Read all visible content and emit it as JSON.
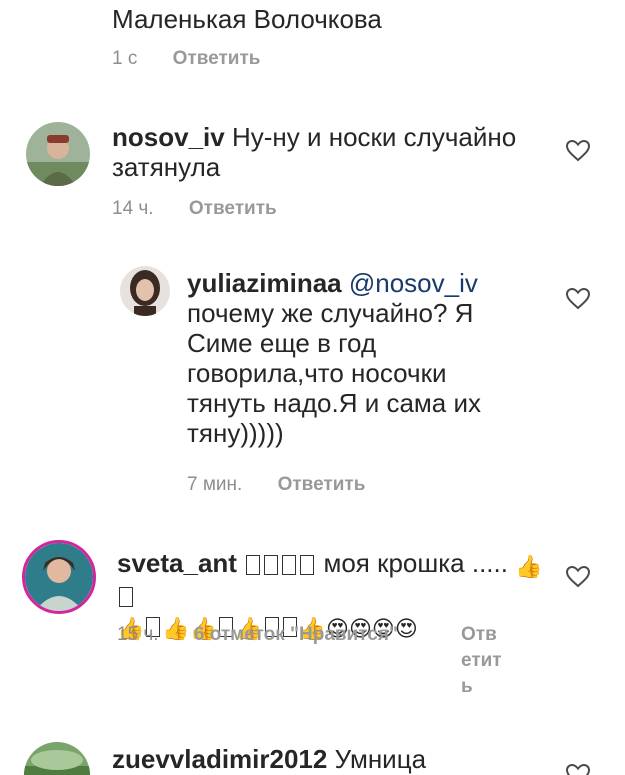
{
  "top_partial": {
    "text": "Маленькая Волочкова",
    "time": "1 с",
    "reply": "Ответить"
  },
  "comments": [
    {
      "username": "nosov_iv",
      "text": "Ну-ну и носки случайно затянула",
      "time": "14 ч.",
      "reply": "Ответить"
    },
    {
      "username": "yuliaziminaa",
      "mention": "@nosov_iv",
      "text": "почему же случайно? Я Симе еще в год говорила,что носочки тянуть надо.Я и сама их тяну)))))",
      "time": "7 мин.",
      "reply": "Ответить"
    },
    {
      "username": "sveta_ant",
      "text": "моя крошка .....",
      "time": "15 ч.",
      "likes": "6 отметок \"Нравится\"",
      "reply_lines": [
        "Отв",
        "етит",
        "ь"
      ]
    },
    {
      "username": "zuevvladimir2012",
      "text": "Умница"
    }
  ],
  "icons": {
    "like": "heart-outline-icon",
    "unsupported_glyph": "missing-glyph-box",
    "emoji_thumb": "thumbs-up-emoji",
    "emoji_heart_eyes": "heart-eyes-emoji"
  }
}
